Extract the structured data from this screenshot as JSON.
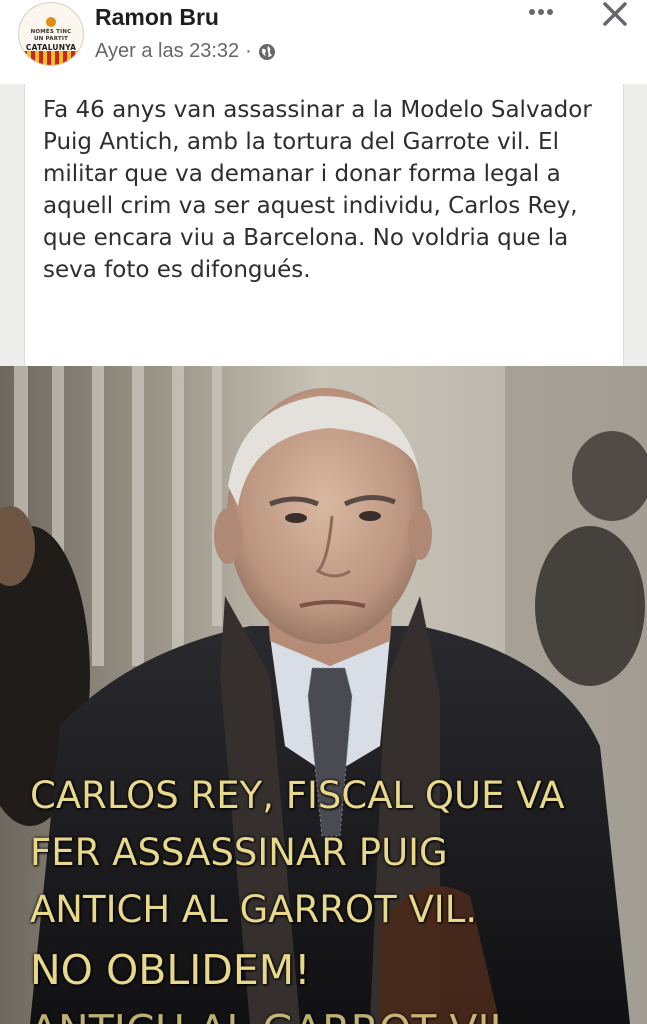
{
  "post": {
    "author": "Ramon Bru",
    "timestamp": "Ayer a las 23:32",
    "separator": "·",
    "audience_icon": "globe-icon",
    "more_icon": "more-icon",
    "close_icon": "close-icon"
  },
  "avatar": {
    "line1": "NOMÉS TINC",
    "line2": "UN PARTIT",
    "line3": "CATALUNYA"
  },
  "image": {
    "caption": "Fa 46 anys van assassinar a la Modelo Salvador Puig Antich, amb la tortura del Garrote vil. El militar que va demanar i donar forma legal a aquell crim va ser aquest individu, Carlos Rey, que encara viu a Barcelona. No voldria que la seva foto es difongués.",
    "overlay_lines": [
      "CARLOS REY, FISCAL QUE VA",
      "FER ASSASSINAR PUIG",
      "ANTICH AL GARROT VIL.",
      "NO OBLIDEM!",
      "ANTICH AL GARROT VIL"
    ],
    "overlay_color": "#e8d88a"
  }
}
